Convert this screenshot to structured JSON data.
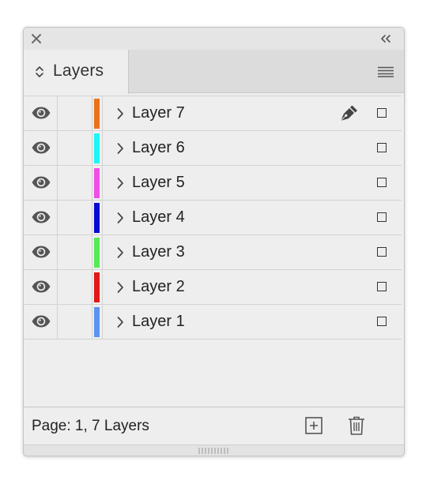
{
  "panel": {
    "title": "Layers",
    "status": "Page: 1, 7 Layers"
  },
  "layers": [
    {
      "name": "Layer 7",
      "color": "#e8731a",
      "visible": true,
      "active": true
    },
    {
      "name": "Layer 6",
      "color": "#1ff5f5",
      "visible": true,
      "active": false
    },
    {
      "name": "Layer 5",
      "color": "#ef4fe4",
      "visible": true,
      "active": false
    },
    {
      "name": "Layer 4",
      "color": "#0a0ad0",
      "visible": true,
      "active": false
    },
    {
      "name": "Layer 3",
      "color": "#55ea55",
      "visible": true,
      "active": false
    },
    {
      "name": "Layer 2",
      "color": "#e01818",
      "visible": true,
      "active": false
    },
    {
      "name": "Layer 1",
      "color": "#5b93ee",
      "visible": true,
      "active": false
    }
  ],
  "icons": {
    "close": "close-icon",
    "collapse": "double-chevron-left-icon",
    "panel_menu": "hamburger-menu-icon",
    "visibility": "eye-icon",
    "expand": "chevron-right-icon",
    "target_layer": "pen-nib-icon",
    "new_layer": "new-layer-icon",
    "delete_layer": "trash-icon"
  }
}
